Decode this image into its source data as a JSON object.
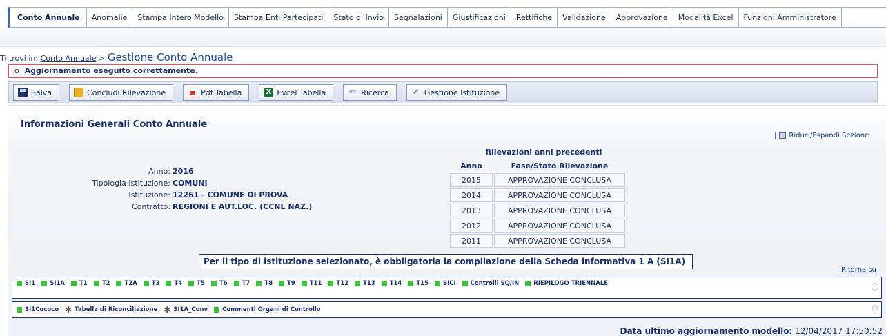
{
  "nav": {
    "tabs": [
      {
        "label": "Conto Annuale",
        "active": true
      },
      {
        "label": "Anomalie"
      },
      {
        "label": "Stampa Intero Modello"
      },
      {
        "label": "Stampa Enti Partecipati"
      },
      {
        "label": "Stato di Invio"
      },
      {
        "label": "Segnalazioni"
      },
      {
        "label": "Giustificazioni"
      },
      {
        "label": "Rettifiche"
      },
      {
        "label": "Validazione"
      },
      {
        "label": "Approvazione"
      },
      {
        "label": "Modalità Excel"
      },
      {
        "label": "Funzioni Amministratore"
      }
    ]
  },
  "breadcrumb": {
    "prefix": "Ti trovi in:",
    "link": "Conto Annuale",
    "separator": ">",
    "current": "Gestione Conto Annuale"
  },
  "message": {
    "bullet": "o",
    "text": "Aggiornamento eseguito correttamente."
  },
  "toolbar": {
    "salva": "Salva",
    "concludi": "Concludi Rilevazione",
    "pdf": "Pdf Tabella",
    "excel": "Excel Tabella",
    "ricerca": "Ricerca",
    "istituzione": "Gestione Istituzione"
  },
  "section": {
    "title": "Informazioni Generali Conto Annuale",
    "toggle_label": "Riduci/Espandi Sezione",
    "toggle_sep": "|"
  },
  "info": {
    "rows": [
      {
        "label": "Anno:",
        "value": "2016"
      },
      {
        "label": "Tipologia Istituzione:",
        "value": "COMUNI"
      },
      {
        "label": "Istituzione:",
        "value": "12261  -  COMUNE DI PROVA"
      },
      {
        "label": "Contratto:",
        "value": "REGIONI E AUT.LOC. (CCNL NAZ.)"
      }
    ]
  },
  "previous": {
    "caption": "Rilevazioni anni precedenti",
    "col_year": "Anno",
    "col_status": "Fase/Stato Rilevazione",
    "rows": [
      {
        "year": "2015",
        "status": "APPROVAZIONE CONCLUSA"
      },
      {
        "year": "2014",
        "status": "APPROVAZIONE CONCLUSA"
      },
      {
        "year": "2013",
        "status": "APPROVAZIONE CONCLUSA"
      },
      {
        "year": "2012",
        "status": "APPROVAZIONE CONCLUSA"
      },
      {
        "year": "2011",
        "status": "APPROVAZIONE CONCLUSA"
      }
    ]
  },
  "note": "Per il tipo di istituzione selezionato, è obbligatoria la compilazione della Scheda informativa 1 A (SI1A)",
  "back_to_top": "Ritorna su",
  "schede_row1": [
    "SI1",
    "SI1A",
    "T1",
    "T2",
    "T2A",
    "T3",
    "T4",
    "T5",
    "T6",
    "T7",
    "T8",
    "T9",
    "T11",
    "T12",
    "T13",
    "T14",
    "T15",
    "SICI",
    "Controlli SQ/IN",
    "RIEPILOGO TRIENNALE"
  ],
  "schede_row2": [
    {
      "label": "SI1Cococo",
      "icon": "green-square"
    },
    {
      "label": "Tabella di Riconciliazione",
      "icon": "star"
    },
    {
      "label": "SI1A_Conv",
      "icon": "star"
    },
    {
      "label": "Commenti Organi di Controllo",
      "icon": "green-square"
    }
  ],
  "footer": {
    "label": "Data ultimo aggiornamento modello:",
    "value": "12/04/2017 17:50:52"
  },
  "colors": {
    "accent": "#1b2f6b",
    "alert_border": "#e05050",
    "scheda_ok": "#3fbf3f"
  }
}
